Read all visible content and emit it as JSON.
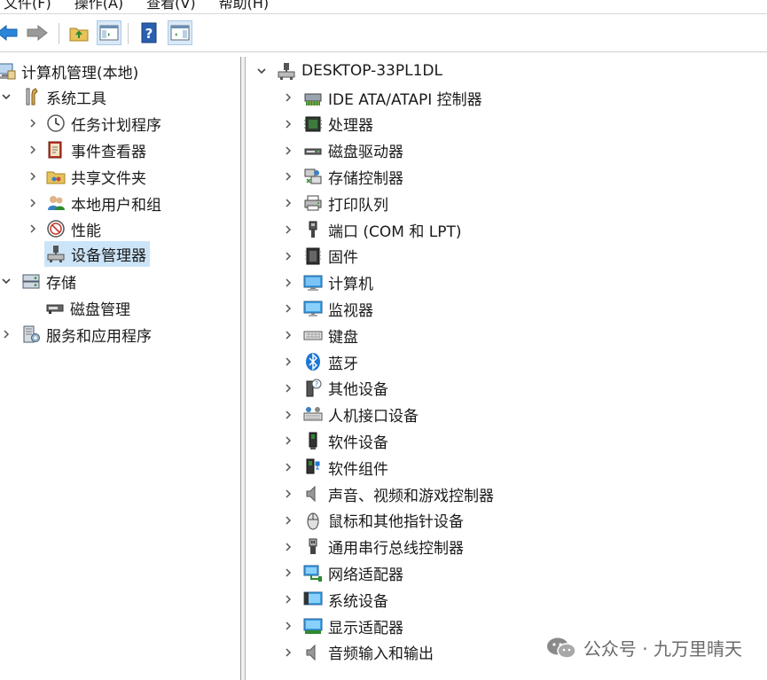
{
  "menu": [
    "文件(F)",
    "操作(A)",
    "查看(V)",
    "帮助(H)"
  ],
  "toolbar": {
    "buttons": [
      "back-icon",
      "forward-icon",
      "up-folder-icon",
      "show-hide-tree-icon",
      "help-icon",
      "action-pane-icon"
    ]
  },
  "left_tree": {
    "root": "计算机管理(本地)",
    "system_tools": "系统工具",
    "task_scheduler": "任务计划程序",
    "event_viewer": "事件查看器",
    "shared_folders": "共享文件夹",
    "local_users": "本地用户和组",
    "performance": "性能",
    "device_manager": "设备管理器",
    "storage": "存储",
    "disk_management": "磁盘管理",
    "services_apps": "服务和应用程序"
  },
  "device_tree": {
    "computer": "DESKTOP-33PL1DL",
    "categories": [
      {
        "label": "IDE ATA/ATAPI 控制器",
        "icon": "ide-controller-icon"
      },
      {
        "label": "处理器",
        "icon": "processor-icon"
      },
      {
        "label": "磁盘驱动器",
        "icon": "disk-drive-icon"
      },
      {
        "label": "存储控制器",
        "icon": "storage-controller-icon"
      },
      {
        "label": "打印队列",
        "icon": "printer-icon"
      },
      {
        "label": "端口 (COM 和 LPT)",
        "icon": "port-icon"
      },
      {
        "label": "固件",
        "icon": "firmware-icon"
      },
      {
        "label": "计算机",
        "icon": "computer-icon"
      },
      {
        "label": "监视器",
        "icon": "monitor-icon"
      },
      {
        "label": "键盘",
        "icon": "keyboard-icon"
      },
      {
        "label": "蓝牙",
        "icon": "bluetooth-icon"
      },
      {
        "label": "其他设备",
        "icon": "unknown-device-icon"
      },
      {
        "label": "人机接口设备",
        "icon": "hid-icon"
      },
      {
        "label": "软件设备",
        "icon": "software-device-icon"
      },
      {
        "label": "软件组件",
        "icon": "software-component-icon"
      },
      {
        "label": "声音、视频和游戏控制器",
        "icon": "speaker-icon"
      },
      {
        "label": "鼠标和其他指针设备",
        "icon": "mouse-icon"
      },
      {
        "label": "通用串行总线控制器",
        "icon": "usb-icon"
      },
      {
        "label": "网络适配器",
        "icon": "network-adapter-icon"
      },
      {
        "label": "系统设备",
        "icon": "system-device-icon"
      },
      {
        "label": "显示适配器",
        "icon": "display-adapter-icon"
      },
      {
        "label": "音频输入和输出",
        "icon": "audio-io-icon"
      }
    ]
  },
  "watermark": {
    "text": "公众号 · 九万里晴天"
  },
  "colors": {
    "selection": "#cce4f7",
    "accent_blue": "#1e78d4"
  }
}
